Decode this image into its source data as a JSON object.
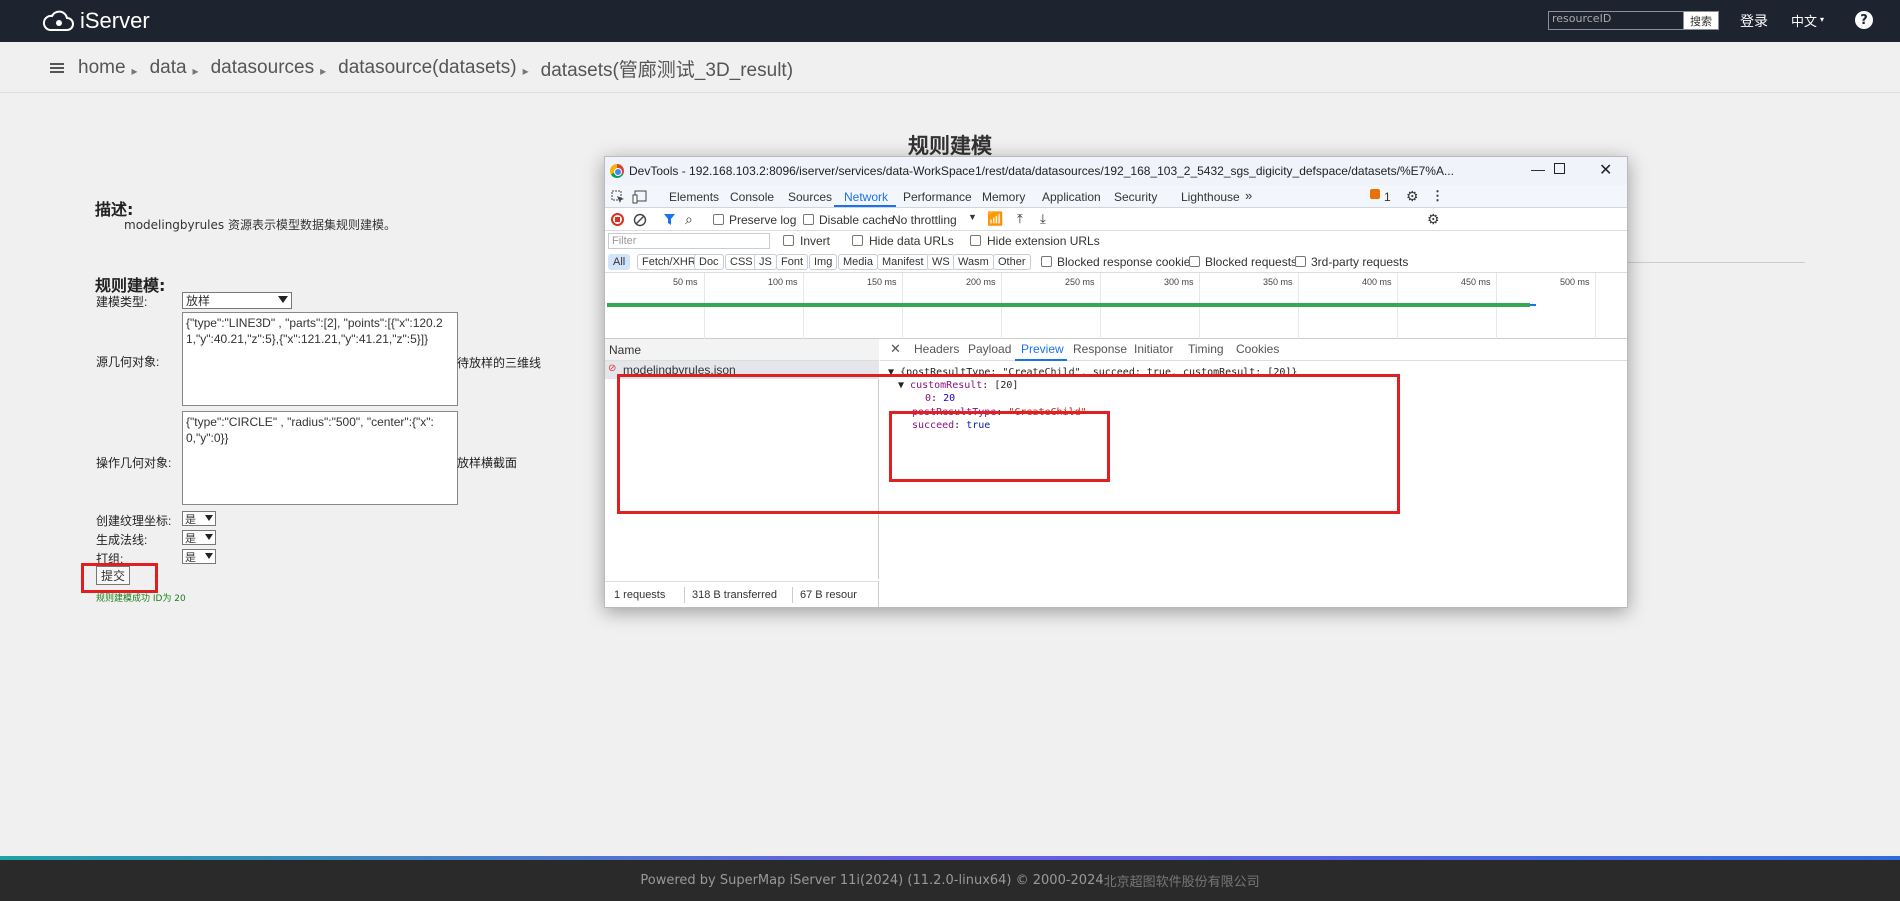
{
  "header": {
    "logo_text": "iServer",
    "search_placeholder": "resourceID",
    "search_button": "搜索",
    "login": "登录",
    "language": "中文"
  },
  "breadcrumb": [
    "home",
    "data",
    "datasources",
    "datasource(datasets)",
    "datasets(管廊测试_3D_result)"
  ],
  "page": {
    "title": "规则建模",
    "description_heading": "描述:",
    "description_text": "modelingbyrules 资源表示模型数据集规则建模。",
    "form_heading": "规则建模:",
    "model_type_label": "建模类型:",
    "model_type_value": "放样",
    "source_geometry_label": "源几何对象:",
    "source_geometry_value": "{\"type\":\"LINE3D\" , \"parts\":[2], \"points\":[{\"x\":120.21,\"y\":40.21,\"z\":5},{\"x\":121.21,\"y\":41.21,\"z\":5}]}",
    "source_geometry_hint": "待放样的三维线",
    "operate_geometry_label": "操作几何对象:",
    "operate_geometry_value": "{\"type\":\"CIRCLE\" , \"radius\":\"500\", \"center\":{\"x\":0,\"y\":0}}",
    "operate_geometry_hint": "放样横截面",
    "texture_label": "创建纹理坐标:",
    "texture_value": "是",
    "normal_label": "生成法线:",
    "normal_value": "是",
    "group_label": "打组:",
    "group_value": "是",
    "submit_label": "提交",
    "result_text": "规则建模成功 ID为 20"
  },
  "footer": {
    "text": "Powered by SuperMap iServer 11i(2024) (11.2.0-linux64) © 2000-2024 ",
    "company": "北京超图软件股份有限公司"
  },
  "devtools": {
    "title": "DevTools - 192.168.103.2:8096/iserver/services/data-WorkSpace1/rest/data/datasources/192_168_103_2_5432_sgs_digicity_defspace/datasets/%E7%A...",
    "tabs": [
      "Elements",
      "Console",
      "Sources",
      "Network",
      "Performance",
      "Memory",
      "Application",
      "Security",
      "Lighthouse"
    ],
    "issues_count": "1",
    "toolbar": {
      "preserve_log": "Preserve log",
      "disable_cache": "Disable cache",
      "throttling": "No throttling"
    },
    "filter": {
      "placeholder": "Filter",
      "invert": "Invert",
      "hide_data_urls": "Hide data URLs",
      "hide_extension_urls": "Hide extension URLs"
    },
    "types": [
      "All",
      "Fetch/XHR",
      "Doc",
      "CSS",
      "JS",
      "Font",
      "Img",
      "Media",
      "Manifest",
      "WS",
      "Wasm",
      "Other"
    ],
    "type_options": {
      "blocked_cookies": "Blocked response cookies",
      "blocked_requests": "Blocked requests",
      "third_party": "3rd-party requests"
    },
    "timeline_ticks": [
      "50 ms",
      "100 ms",
      "150 ms",
      "200 ms",
      "250 ms",
      "300 ms",
      "350 ms",
      "400 ms",
      "450 ms",
      "500 ms"
    ],
    "name_header": "Name",
    "request_name": "modelingbyrules.json",
    "preview_tabs": [
      "Headers",
      "Payload",
      "Preview",
      "Response",
      "Initiator",
      "Timing",
      "Cookies"
    ],
    "json": {
      "summary": "{postResultType: \"CreateChild\", succeed: true, customResult: [20]}",
      "custom_result_key": "customResult",
      "custom_result_summary": "[20]",
      "index0": "0",
      "index0_value": "20",
      "post_result_key": "postResultType",
      "post_result_value": "\"CreateChild\"",
      "succeed_key": "succeed",
      "succeed_value": "true"
    },
    "status": {
      "requests": "1 requests",
      "transferred": "318 B transferred",
      "resources": "67 B resour"
    }
  }
}
